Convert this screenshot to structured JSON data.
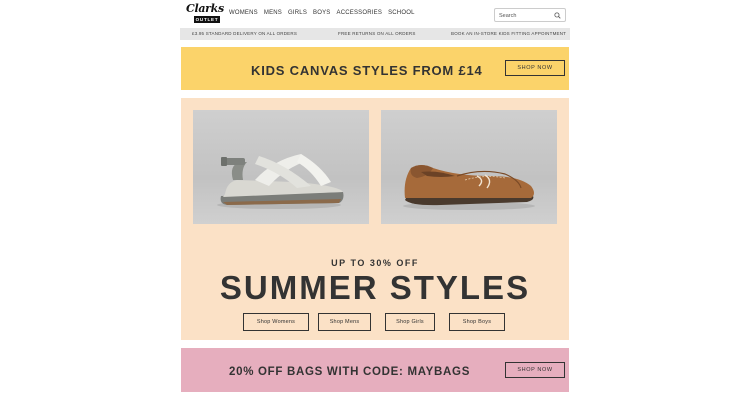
{
  "header": {
    "logo": {
      "brand": "Clarks",
      "sub": "OUTLET"
    },
    "nav": [
      "WOMENS",
      "MENS",
      "GIRLS",
      "BOYS",
      "ACCESSORIES",
      "SCHOOL"
    ],
    "search": {
      "placeholder": "Search",
      "icon": "search-icon"
    }
  },
  "strip": {
    "delivery": "£3.95 STANDARD DELIVERY ON ALL ORDERS",
    "returns": "FREE RETURNS ON ALL ORDERS",
    "fitting": "BOOK AN IN-STORE KIDS FITTING APPOINTMENT"
  },
  "kids_banner": {
    "headline": "KIDS CANVAS STYLES FROM £14",
    "cta": "SHOP NOW",
    "color": "#fbd36a"
  },
  "summer": {
    "pre": "UP TO 30% OFF",
    "headline": "SUMMER STYLES",
    "buttons": [
      "Shop Womens",
      "Shop Mens",
      "Shop Girls",
      "Shop Boys"
    ],
    "images": [
      "sandal-image",
      "loafer-image"
    ],
    "color": "#fbe1c6"
  },
  "bags_banner": {
    "headline": "20% OFF BAGS WITH CODE: MAYBAGS",
    "cta": "SHOP NOW",
    "color": "#e6aebe"
  }
}
